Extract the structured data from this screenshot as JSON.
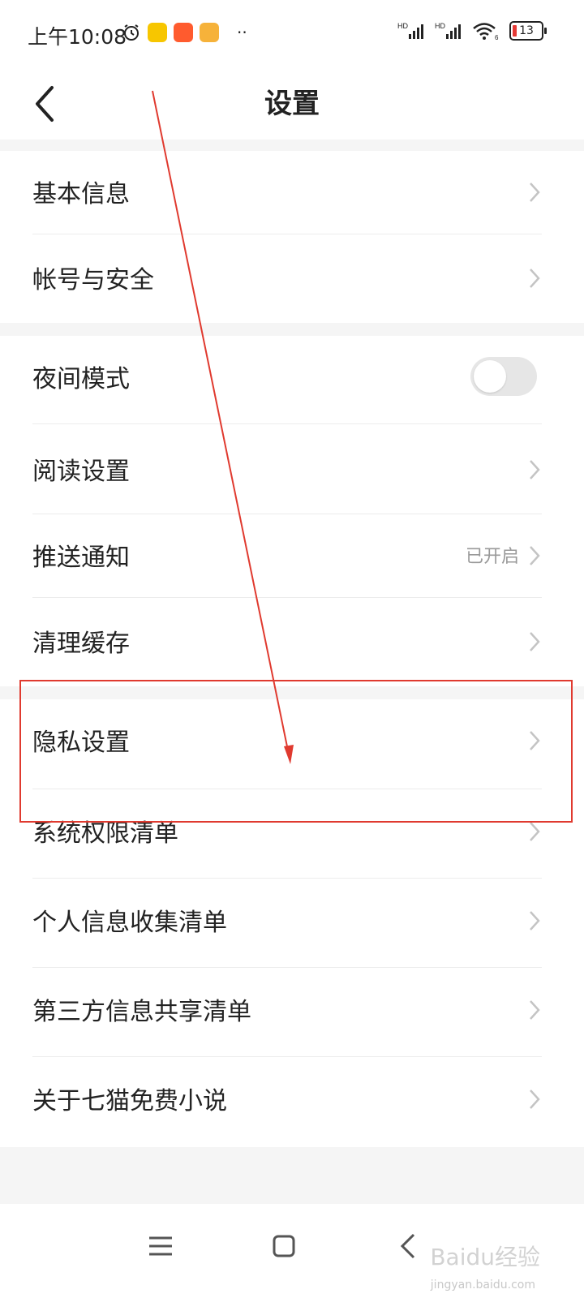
{
  "status_bar": {
    "time": "上午10:08",
    "signal_label_1": "HD",
    "signal_label_2": "HD",
    "wifi_sub": "6",
    "battery_level": "13",
    "more": "··"
  },
  "header": {
    "title": "设置"
  },
  "groups": [
    {
      "items": [
        {
          "label": "基本信息"
        },
        {
          "label": "帐号与安全"
        }
      ]
    },
    {
      "items": [
        {
          "label": "夜间模式",
          "toggle": false
        },
        {
          "label": "阅读设置"
        },
        {
          "label": "推送通知",
          "value": "已开启"
        },
        {
          "label": "清理缓存"
        }
      ]
    },
    {
      "items": [
        {
          "label": "隐私设置"
        },
        {
          "label": "系统权限清单"
        },
        {
          "label": "个人信息收集清单"
        },
        {
          "label": "第三方信息共享清单"
        },
        {
          "label": "关于七猫免费小说"
        }
      ]
    }
  ],
  "navbar": {
    "menu_icon": "menu-icon",
    "home_icon": "home-icon",
    "back_icon": "back-icon"
  },
  "watermark": {
    "logo_text": "Baidu经验",
    "site_text": "jingyan.baidu.com"
  },
  "colors": {
    "annotation_red": "#e03a2f",
    "toggle_off": "#e6e6e6",
    "value_gray": "#999999"
  }
}
